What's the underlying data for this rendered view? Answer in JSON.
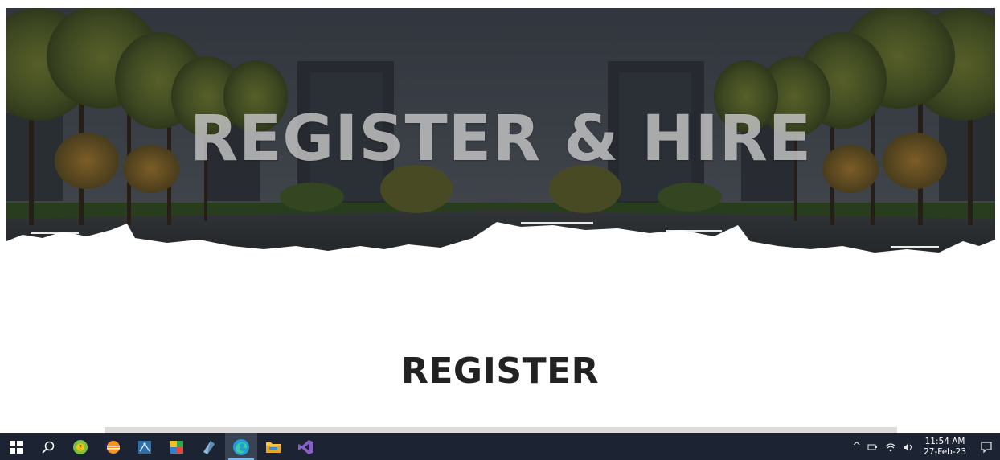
{
  "hero": {
    "title": "REGISTER & HIRE"
  },
  "section": {
    "title": "REGISTER"
  },
  "taskbar": {
    "apps": [
      {
        "name": "start-icon"
      },
      {
        "name": "search-icon"
      },
      {
        "name": "green-app-icon"
      },
      {
        "name": "eclipse-icon"
      },
      {
        "name": "network-app-icon"
      },
      {
        "name": "tools-app-icon"
      },
      {
        "name": "diamond-app-icon"
      },
      {
        "name": "edge-icon",
        "active": true
      },
      {
        "name": "file-explorer-icon"
      },
      {
        "name": "visual-studio-icon"
      }
    ],
    "tray": {
      "clock_time": "11:54 AM",
      "clock_date": "27-Feb-23"
    }
  },
  "colors": {
    "taskbar_bg": "#1c2433",
    "heading_text": "#222222",
    "hero_overlay": "#3a3f46"
  }
}
